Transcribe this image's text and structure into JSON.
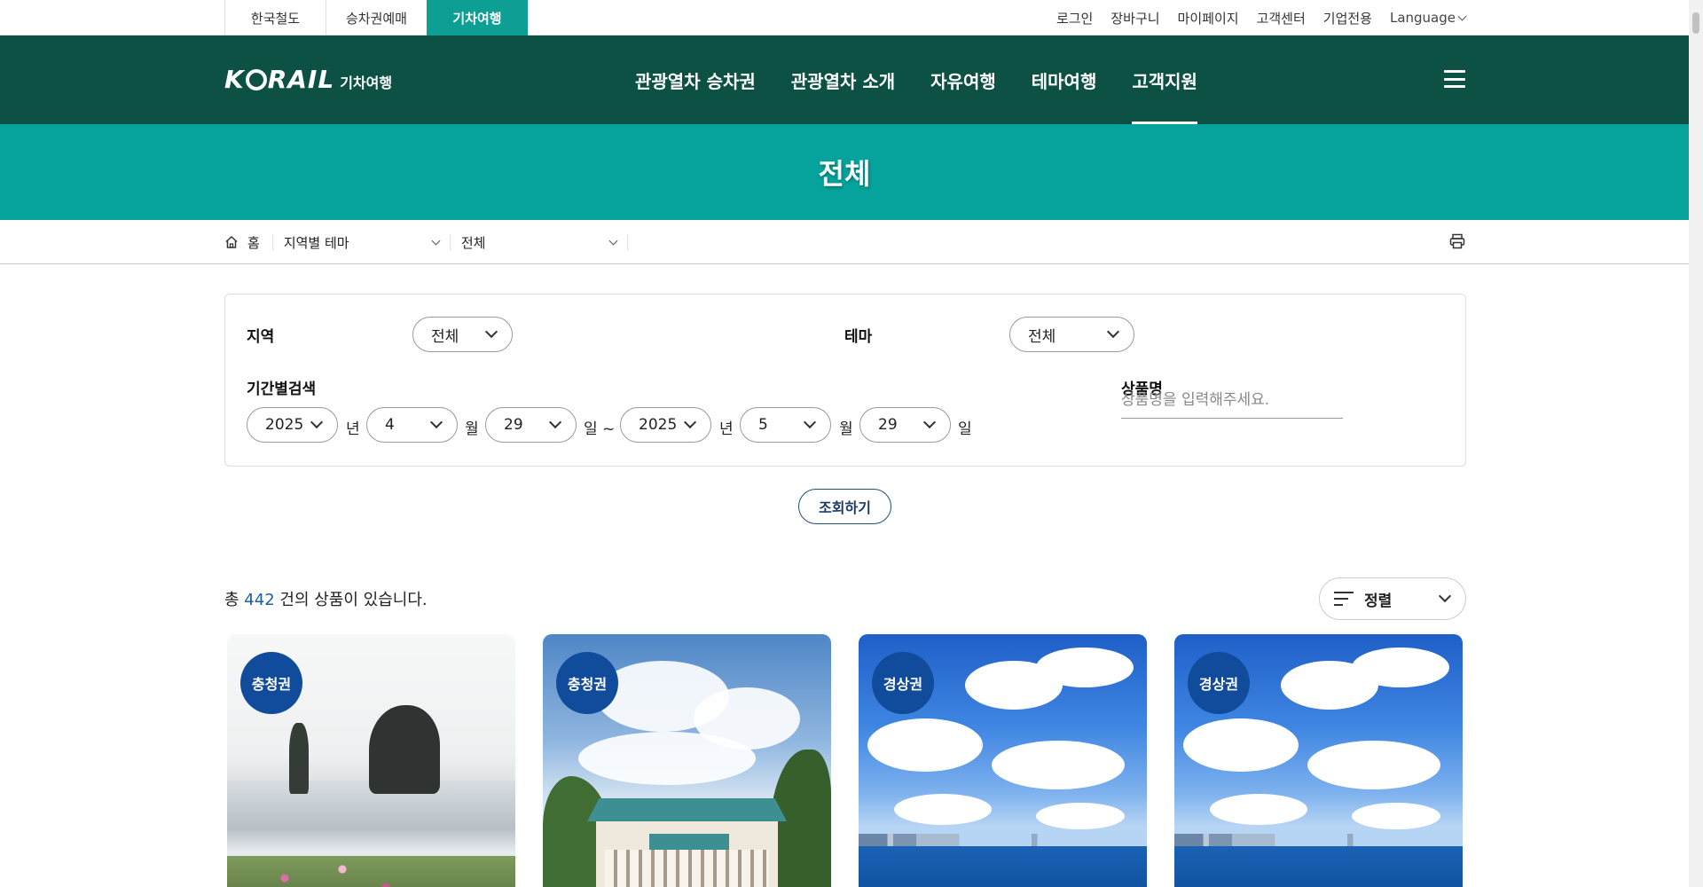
{
  "util": {
    "tabs": [
      "한국철도",
      "승차권예매",
      "기차여행"
    ],
    "links": [
      "로그인",
      "장바구니",
      "마이페이지",
      "고객센터",
      "기업전용"
    ],
    "language": "Language"
  },
  "header": {
    "brand": "KRAIL",
    "brand_sub": "기차여행",
    "nav": [
      "관광열차 승차권",
      "관광열차 소개",
      "자유여행",
      "테마여행",
      "고객지원"
    ]
  },
  "page_title": "전체",
  "breadcrumb": {
    "home": "홈",
    "level1": "지역별 테마",
    "level2": "전체"
  },
  "search": {
    "region_label": "지역",
    "region_value": "전체",
    "theme_label": "테마",
    "theme_value": "전체",
    "period_label": "기간별검색",
    "start": {
      "year": "2025",
      "month": "4",
      "day": "29"
    },
    "end": {
      "year": "2025",
      "month": "5",
      "day": "29"
    },
    "unit_year": "년",
    "unit_month": "월",
    "unit_day": "일",
    "unit_day_sep": "일 ~",
    "name_label": "상품명",
    "name_placeholder": "상품명을 입력해주세요.",
    "submit": "조회하기"
  },
  "results": {
    "prefix": "총",
    "count": "442",
    "suffix": "건의 상품이 있습니다.",
    "sort_label": "정렬"
  },
  "cards": [
    {
      "region": "충청권"
    },
    {
      "region": "충청권"
    },
    {
      "region": "경상권"
    },
    {
      "region": "경상권"
    }
  ],
  "colors": {
    "header_bg": "#0c5144",
    "title_band": "#05a39b",
    "active_tab": "#0d9e94",
    "badge": "#114b9c",
    "count_accent": "#1a5da8"
  }
}
